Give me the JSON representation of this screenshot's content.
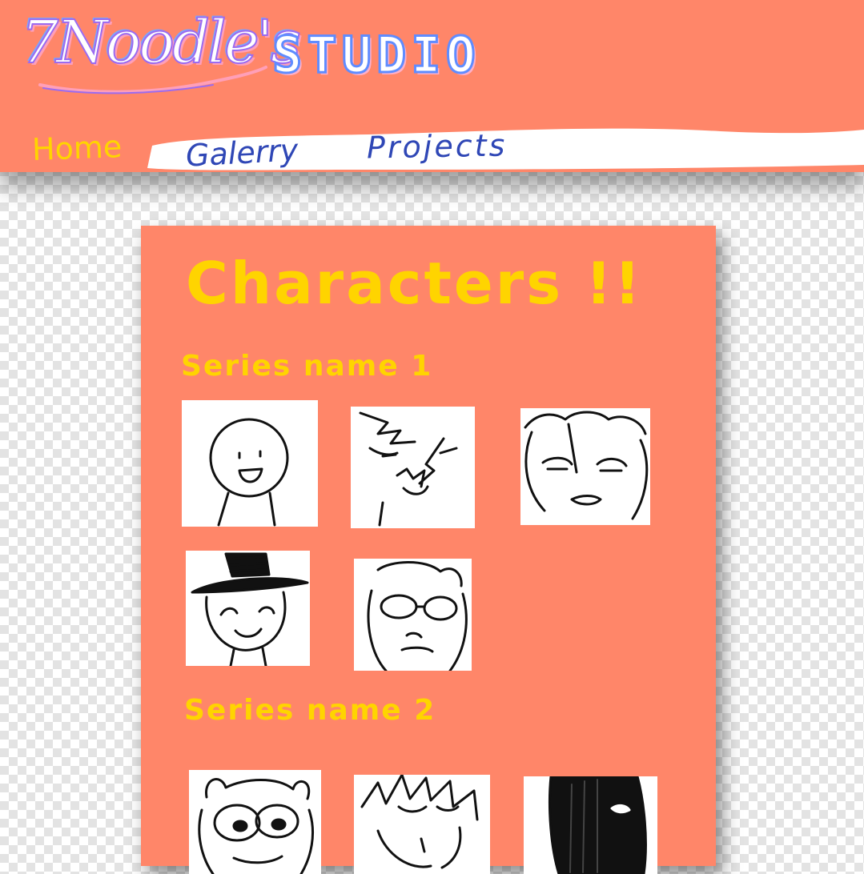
{
  "header": {
    "logo_script": "7Noodle's",
    "logo_studio": "STUDIO"
  },
  "nav": {
    "home": "Home",
    "gallery": "Galerry",
    "projects": "Projects"
  },
  "main": {
    "title": "Characters !!",
    "series": [
      {
        "name": "Series name 1",
        "character_count": 5
      },
      {
        "name": "Series name 2",
        "character_count": 3
      }
    ]
  },
  "colors": {
    "header_bg": "#ff8669",
    "panel_bg": "#ff8669",
    "accent_yellow": "#ffd400",
    "nav_blue": "#2f47b6",
    "nav_bar": "#ffffff",
    "page_bg": "checkerboard"
  }
}
